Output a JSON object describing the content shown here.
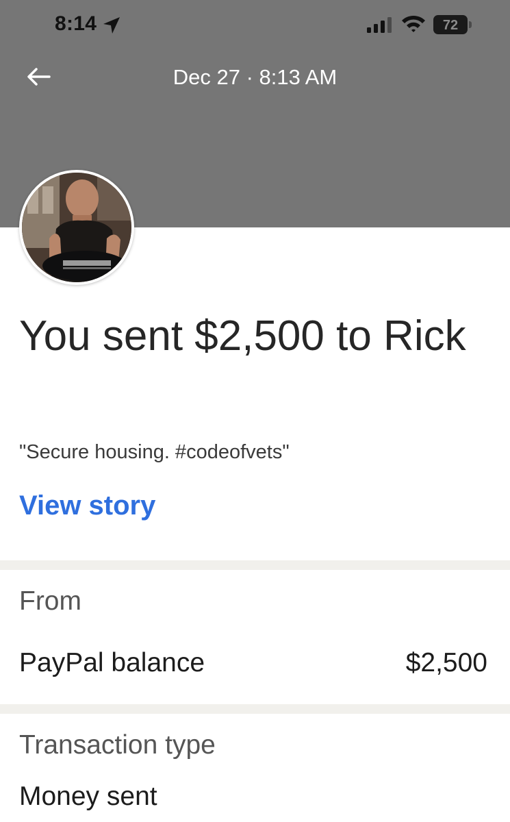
{
  "status_bar": {
    "time": "8:14",
    "battery": "72",
    "icons": [
      "location-arrow-icon",
      "cellular-signal-icon",
      "wifi-icon",
      "battery-icon"
    ]
  },
  "header": {
    "title": "Dec 27 · 8:13 AM",
    "back_icon": "arrow-left-icon",
    "background_color": "#767676"
  },
  "transaction": {
    "headline": "You sent $2,500 to Rick",
    "note": "\"Secure housing. #codeofvets\"",
    "view_story_label": "View story"
  },
  "from_section": {
    "label": "From",
    "source": "PayPal balance",
    "amount": "$2,500"
  },
  "type_section": {
    "label": "Transaction type",
    "value": "Money sent"
  },
  "colors": {
    "link": "#2f6fde",
    "divider": "#f1f0ec"
  }
}
